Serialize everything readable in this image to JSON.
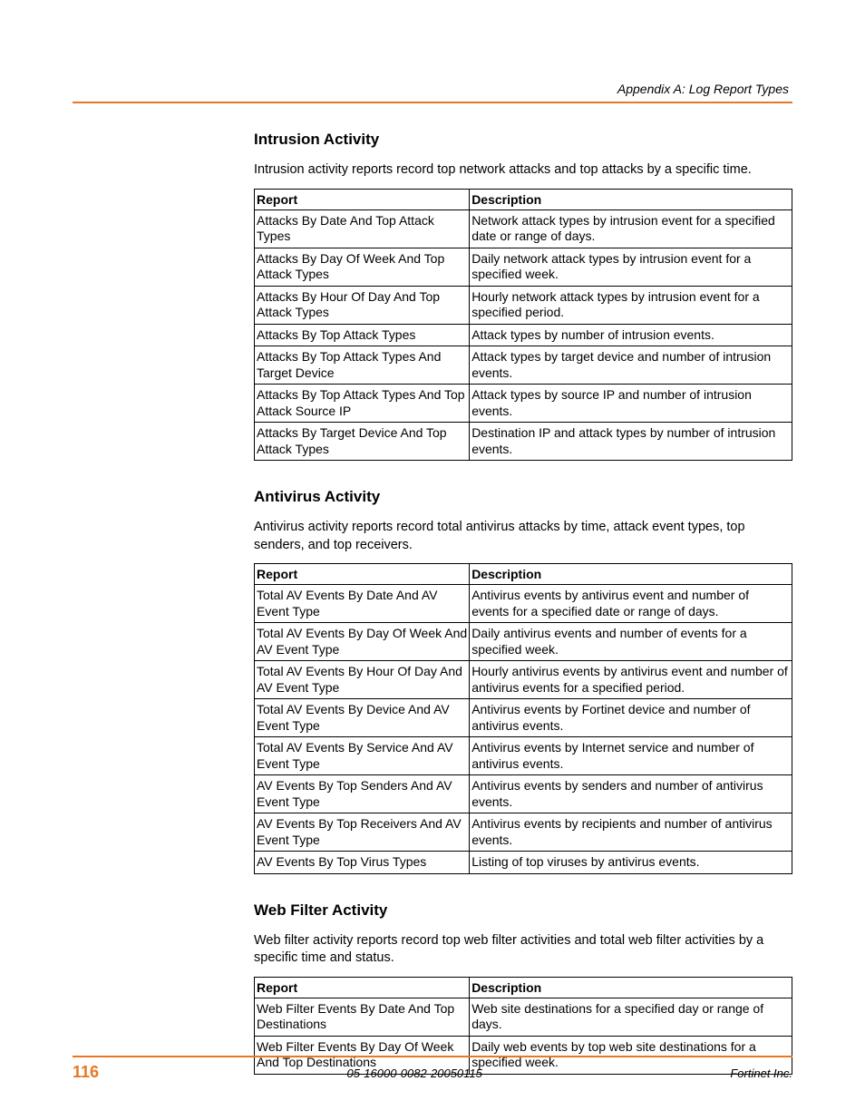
{
  "runningHead": "Appendix A: Log Report Types",
  "sections": [
    {
      "heading": "Intrusion Activity",
      "intro": "Intrusion activity reports record top network attacks and top attacks by a specific time.",
      "headers": {
        "c1": "Report",
        "c2": "Description"
      },
      "rows": [
        {
          "r": "Attacks By Date And Top Attack Types",
          "d": "Network attack types by intrusion event for a specified date or range of days."
        },
        {
          "r": "Attacks By Day Of Week And Top Attack Types",
          "d": "Daily network attack types by intrusion event for a specified week."
        },
        {
          "r": "Attacks By Hour Of Day And Top Attack Types",
          "d": "Hourly network attack types by intrusion event for a specified period."
        },
        {
          "r": "Attacks By Top Attack Types",
          "d": "Attack types by number of intrusion events."
        },
        {
          "r": "Attacks By Top Attack Types And Target Device",
          "d": "Attack types by target device and number of intrusion events."
        },
        {
          "r": "Attacks By Top Attack Types And Top Attack Source IP",
          "d": "Attack types by source IP and number of intrusion events."
        },
        {
          "r": "Attacks By Target Device And Top Attack Types",
          "d": "Destination IP and attack types by number of intrusion events."
        }
      ]
    },
    {
      "heading": "Antivirus Activity",
      "intro": "Antivirus activity reports record total antivirus attacks by time, attack event types, top senders, and top receivers.",
      "headers": {
        "c1": "Report",
        "c2": "Description"
      },
      "rows": [
        {
          "r": "Total AV Events By Date And AV Event Type",
          "d": "Antivirus events by antivirus event and number of events for a specified date or range of days."
        },
        {
          "r": "Total AV Events By Day Of Week And AV Event Type",
          "d": "Daily antivirus events and number of events for a specified week."
        },
        {
          "r": "Total AV Events By Hour Of Day And AV Event Type",
          "d": "Hourly antivirus events by antivirus event and number of antivirus events for a specified period."
        },
        {
          "r": "Total AV Events By Device And AV Event Type",
          "d": "Antivirus events by Fortinet device and number of antivirus events."
        },
        {
          "r": "Total AV Events By Service And AV Event Type",
          "d": "Antivirus events by Internet service and number of antivirus events."
        },
        {
          "r": "AV Events By Top Senders And AV Event Type",
          "d": "Antivirus events by senders and number of antivirus events."
        },
        {
          "r": "AV Events By Top Receivers And AV Event Type",
          "d": "Antivirus events by recipients and number of antivirus events."
        },
        {
          "r": "AV Events By Top Virus Types",
          "d": "Listing of top viruses by antivirus events."
        }
      ]
    },
    {
      "heading": "Web Filter Activity",
      "intro": "Web filter activity reports record top web filter activities and total web filter activities by a specific time and status.",
      "headers": {
        "c1": "Report",
        "c2": "Description"
      },
      "rows": [
        {
          "r": "Web Filter Events By Date And Top Destinations",
          "d": "Web site destinations for a specified day or range of days."
        },
        {
          "r": "Web Filter Events By Day Of Week And Top Destinations",
          "d": "Daily web events by top web site destinations for a specified week."
        }
      ]
    }
  ],
  "footer": {
    "pageNumber": "116",
    "center": "05-16000-0082-20050115",
    "right": "Fortinet Inc."
  }
}
